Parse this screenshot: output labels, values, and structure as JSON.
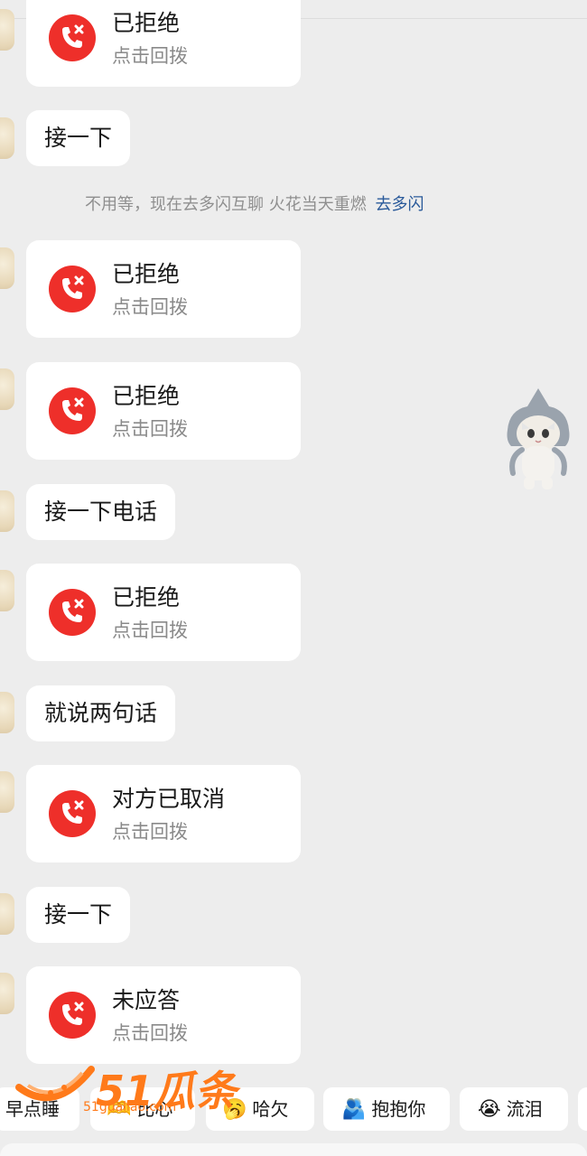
{
  "messages": {
    "m1": {
      "title": "已拒绝",
      "sub": "点击回拨"
    },
    "m2": {
      "text": "接一下"
    },
    "system": {
      "text": "不用等，现在去多闪互聊 火花当天重燃",
      "link": "去多闪"
    },
    "m3": {
      "title": "已拒绝",
      "sub": "点击回拨"
    },
    "m4": {
      "title": "已拒绝",
      "sub": "点击回拨"
    },
    "m5": {
      "text": "接一下电话"
    },
    "m6": {
      "title": "已拒绝",
      "sub": "点击回拨"
    },
    "m7": {
      "text": "就说两句话"
    },
    "m8": {
      "title": "对方已取消",
      "sub": "点击回拨"
    },
    "m9": {
      "text": "接一下"
    },
    "m10": {
      "title": "未应答",
      "sub": "点击回拨"
    }
  },
  "quick_replies": [
    {
      "label": "早点睡",
      "emoji": ""
    },
    {
      "label": "比心",
      "emoji": "🫶"
    },
    {
      "label": "哈欠",
      "emoji": "🥱"
    },
    {
      "label": "抱抱你",
      "emoji": "🫂"
    },
    {
      "label": "流泪",
      "emoji": "😭"
    }
  ],
  "watermark": {
    "text": "51瓜条",
    "sub": "51gualiao.com"
  },
  "colors": {
    "call_red": "#ee2f2a",
    "link_blue": "#2a5a9a",
    "bg": "#ededed"
  },
  "icons": [
    "missed-call-icon",
    "shark-cat-sticker"
  ]
}
